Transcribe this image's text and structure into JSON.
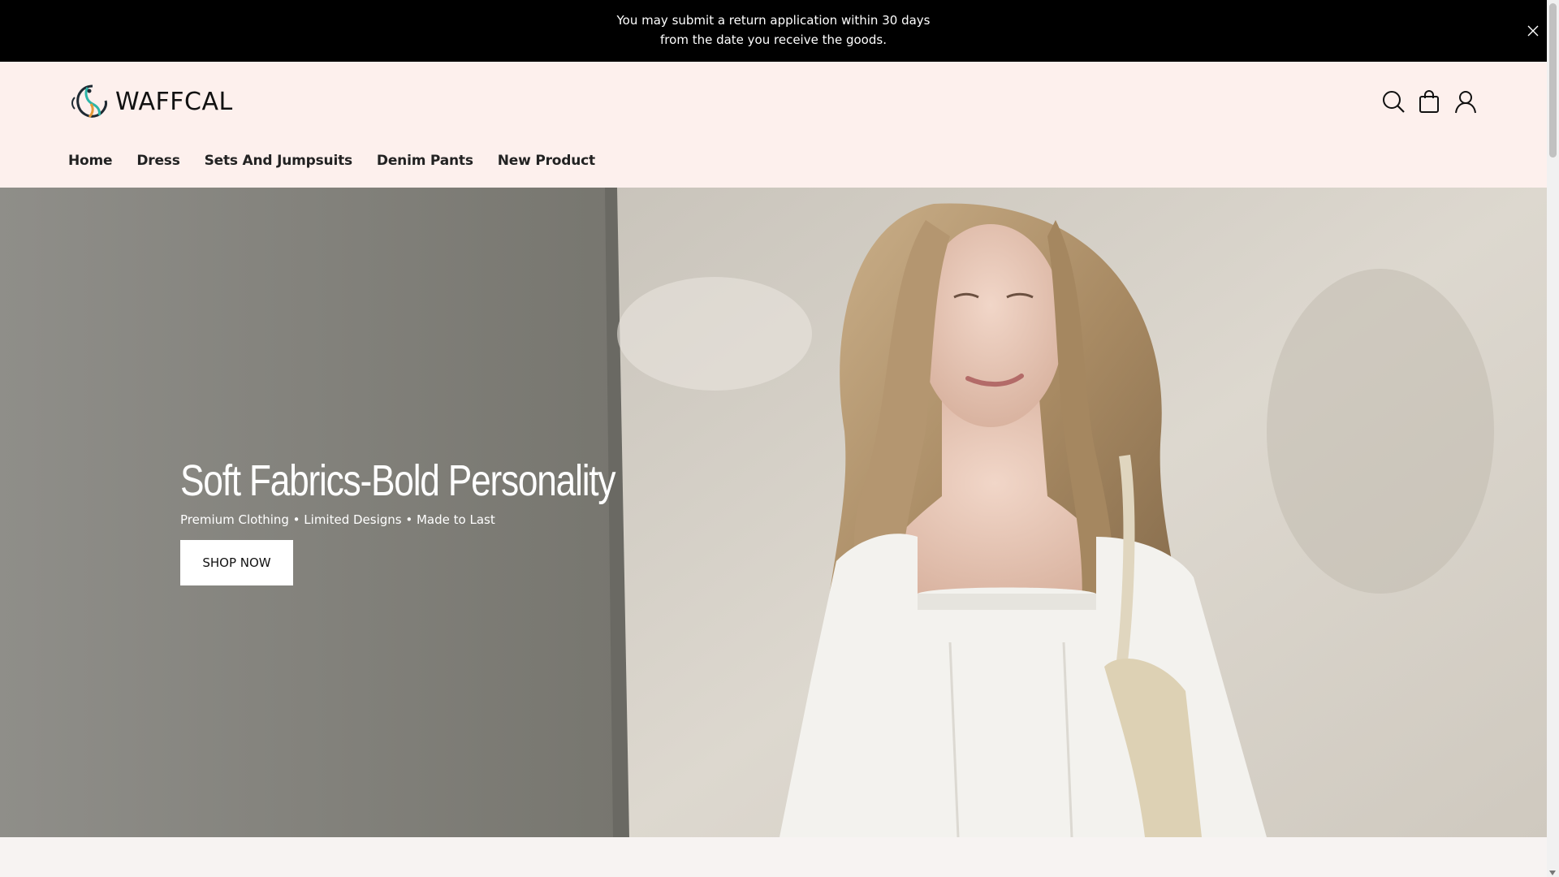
{
  "announcement": {
    "text": "You may submit a return application within 30 days from the date you receive the goods.",
    "close_icon": "close-icon"
  },
  "header": {
    "brand": "WAFFCAL",
    "icons": [
      "search-icon",
      "cart-icon",
      "account-icon"
    ]
  },
  "nav": {
    "items": [
      {
        "label": "Home"
      },
      {
        "label": "Dress"
      },
      {
        "label": "Sets And Jumpsuits"
      },
      {
        "label": "Denim Pants"
      },
      {
        "label": "New Product"
      }
    ]
  },
  "hero": {
    "title": "Soft Fabrics-Bold Personality",
    "subtitle": "Premium Clothing • Limited Designs • Made to Last",
    "cta_label": "SHOP NOW"
  },
  "colors": {
    "announcement_bg": "#000000",
    "header_bg": "#fdf0ed",
    "hero_wall_left": "#8e8d88",
    "hero_wall_right": "#d9d4cb"
  }
}
